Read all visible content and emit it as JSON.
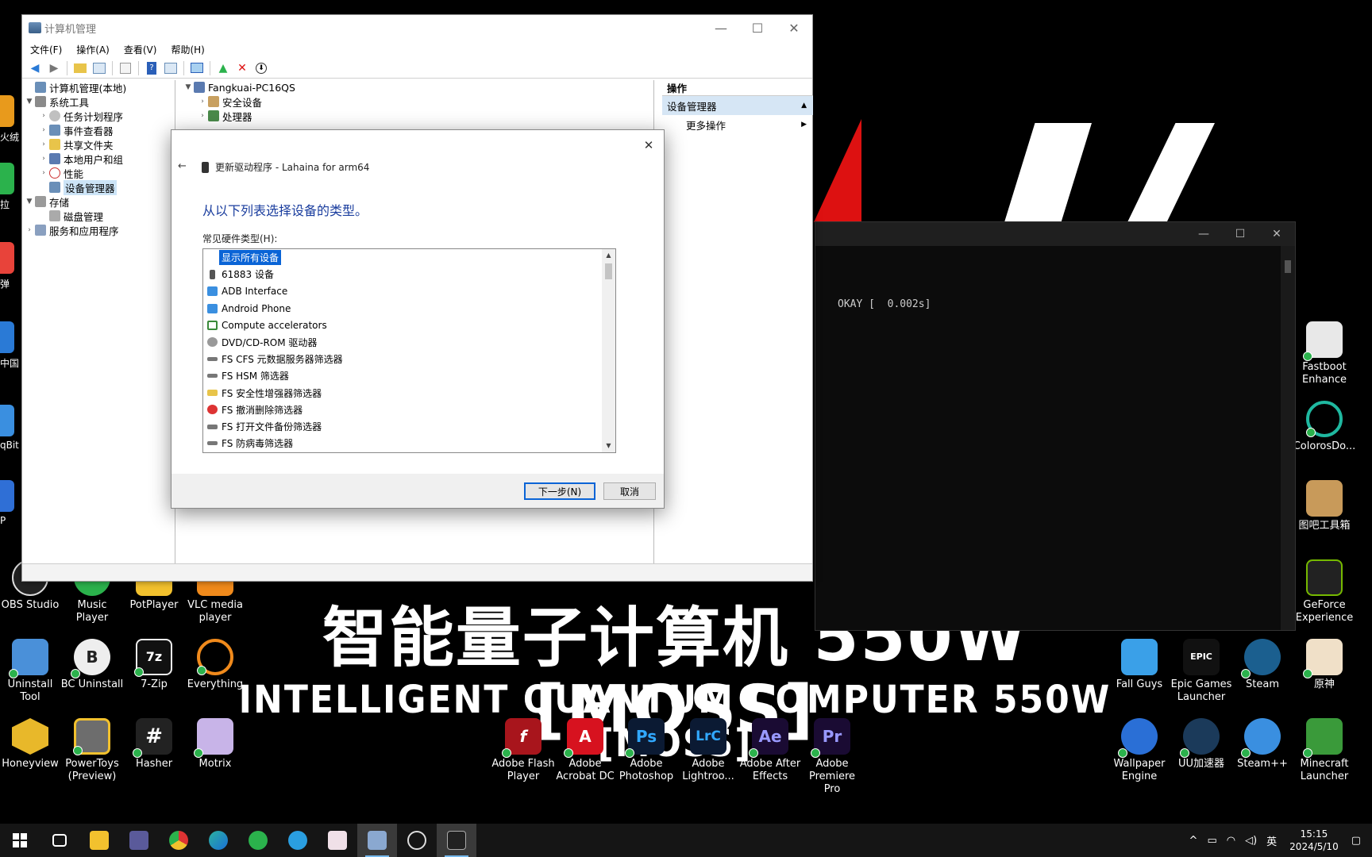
{
  "window": {
    "title": "计算机管理",
    "menu": [
      "文件(F)",
      "操作(A)",
      "查看(V)",
      "帮助(H)"
    ],
    "controls": {
      "minimize": "—",
      "maximize": "☐",
      "close": "✕"
    }
  },
  "tree": {
    "root": "计算机管理(本地)",
    "system_tools": "系统工具",
    "task_scheduler": "任务计划程序",
    "event_viewer": "事件查看器",
    "shared_folders": "共享文件夹",
    "local_users": "本地用户和组",
    "performance": "性能",
    "device_manager": "设备管理器",
    "storage": "存储",
    "disk_management": "磁盘管理",
    "services": "服务和应用程序"
  },
  "center": {
    "computer": "Fangkuai-PC16QS",
    "security_devices": "安全设备",
    "processors": "处理器"
  },
  "actions": {
    "header": "操作",
    "section": "设备管理器",
    "more": "更多操作"
  },
  "dialog": {
    "title": "更新驱动程序 - Lahaina for arm64",
    "heading": "从以下列表选择设备的类型。",
    "list_label": "常见硬件类型(H):",
    "items": [
      "显示所有设备",
      "61883 设备",
      "ADB Interface",
      "Android Phone",
      "Compute accelerators",
      "DVD/CD-ROM 驱动器",
      "FS CFS 元数据服务器筛选器",
      "FS HSM 筛选器",
      "FS 安全性增强器筛选器",
      "FS 撤消删除筛选器",
      "FS 打开文件备份筛选器",
      "FS 防病毒筛选器"
    ],
    "next_button": "下一步(N)",
    "cancel_button": "取消"
  },
  "console": {
    "output": "OKAY [  0.002s]",
    "controls": {
      "minimize": "—",
      "maximize": "☐",
      "close": "✕"
    }
  },
  "desktop": {
    "banner_cn": "智能量子计算机 550W [MOSS]",
    "banner_en": "INTELLIGENT QUANTUM COMPUTER 550W [MOSS]",
    "left_edge": [
      "火绒",
      "拉",
      "弹",
      "中国",
      "qBit",
      "P"
    ],
    "row1": [
      "OBS Studio",
      "Music Player",
      "PotPlayer",
      "VLC media player"
    ],
    "row2": [
      "Uninstall Tool",
      "BC Uninstall",
      "7-Zip",
      "Everything"
    ],
    "row3": [
      "Honeyview",
      "PowerToys (Preview)",
      "Hasher",
      "Motrix"
    ],
    "adobe": [
      "Adobe Flash Player",
      "Adobe Acrobat DC",
      "Adobe Photoshop",
      "Adobe Lightroo...",
      "Adobe After Effects",
      "Adobe Premiere Pro"
    ],
    "adobe_badges": [
      "f",
      "A",
      "Ps",
      "LrC",
      "Ae",
      "Pr"
    ],
    "right_col": [
      "Fastboot Enhance",
      "ColorosDo...",
      "图吧工具箱",
      "GeForce Experience"
    ],
    "right_row1": [
      "Fall Guys",
      "Epic Games Launcher",
      "Steam",
      "原神"
    ],
    "right_row2": [
      "Wallpaper Engine",
      "UU加速器",
      "Steam++",
      "Minecraft Launcher"
    ]
  },
  "taskbar": {
    "ime": "英",
    "time": "15:15",
    "date": "2024/5/10"
  }
}
